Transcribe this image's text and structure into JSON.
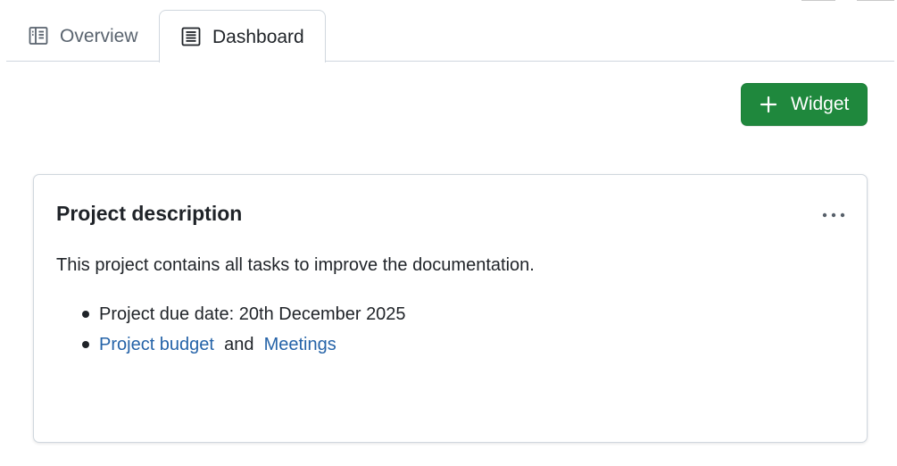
{
  "tabs": {
    "overview_label": "Overview",
    "dashboard_label": "Dashboard",
    "active": "Dashboard"
  },
  "toolbar": {
    "widget_label": "Widget"
  },
  "card": {
    "title": "Project description",
    "description": "This project contains all tasks to improve the documentation.",
    "items": {
      "due_date": "Project due date: 20th December 2025",
      "budget_link": "Project budget",
      "and_text": "and",
      "meetings_link": "Meetings"
    }
  },
  "colors": {
    "primary_button": "#1f883d",
    "link": "#2563a8",
    "border": "#d0d7de",
    "text": "#1f2328",
    "muted_text": "#59636e"
  },
  "icons": {
    "overview_tab": "book-icon",
    "dashboard_tab": "document-lines-icon",
    "widget_button": "plus-icon",
    "card_menu": "kebab-horizontal-icon"
  }
}
